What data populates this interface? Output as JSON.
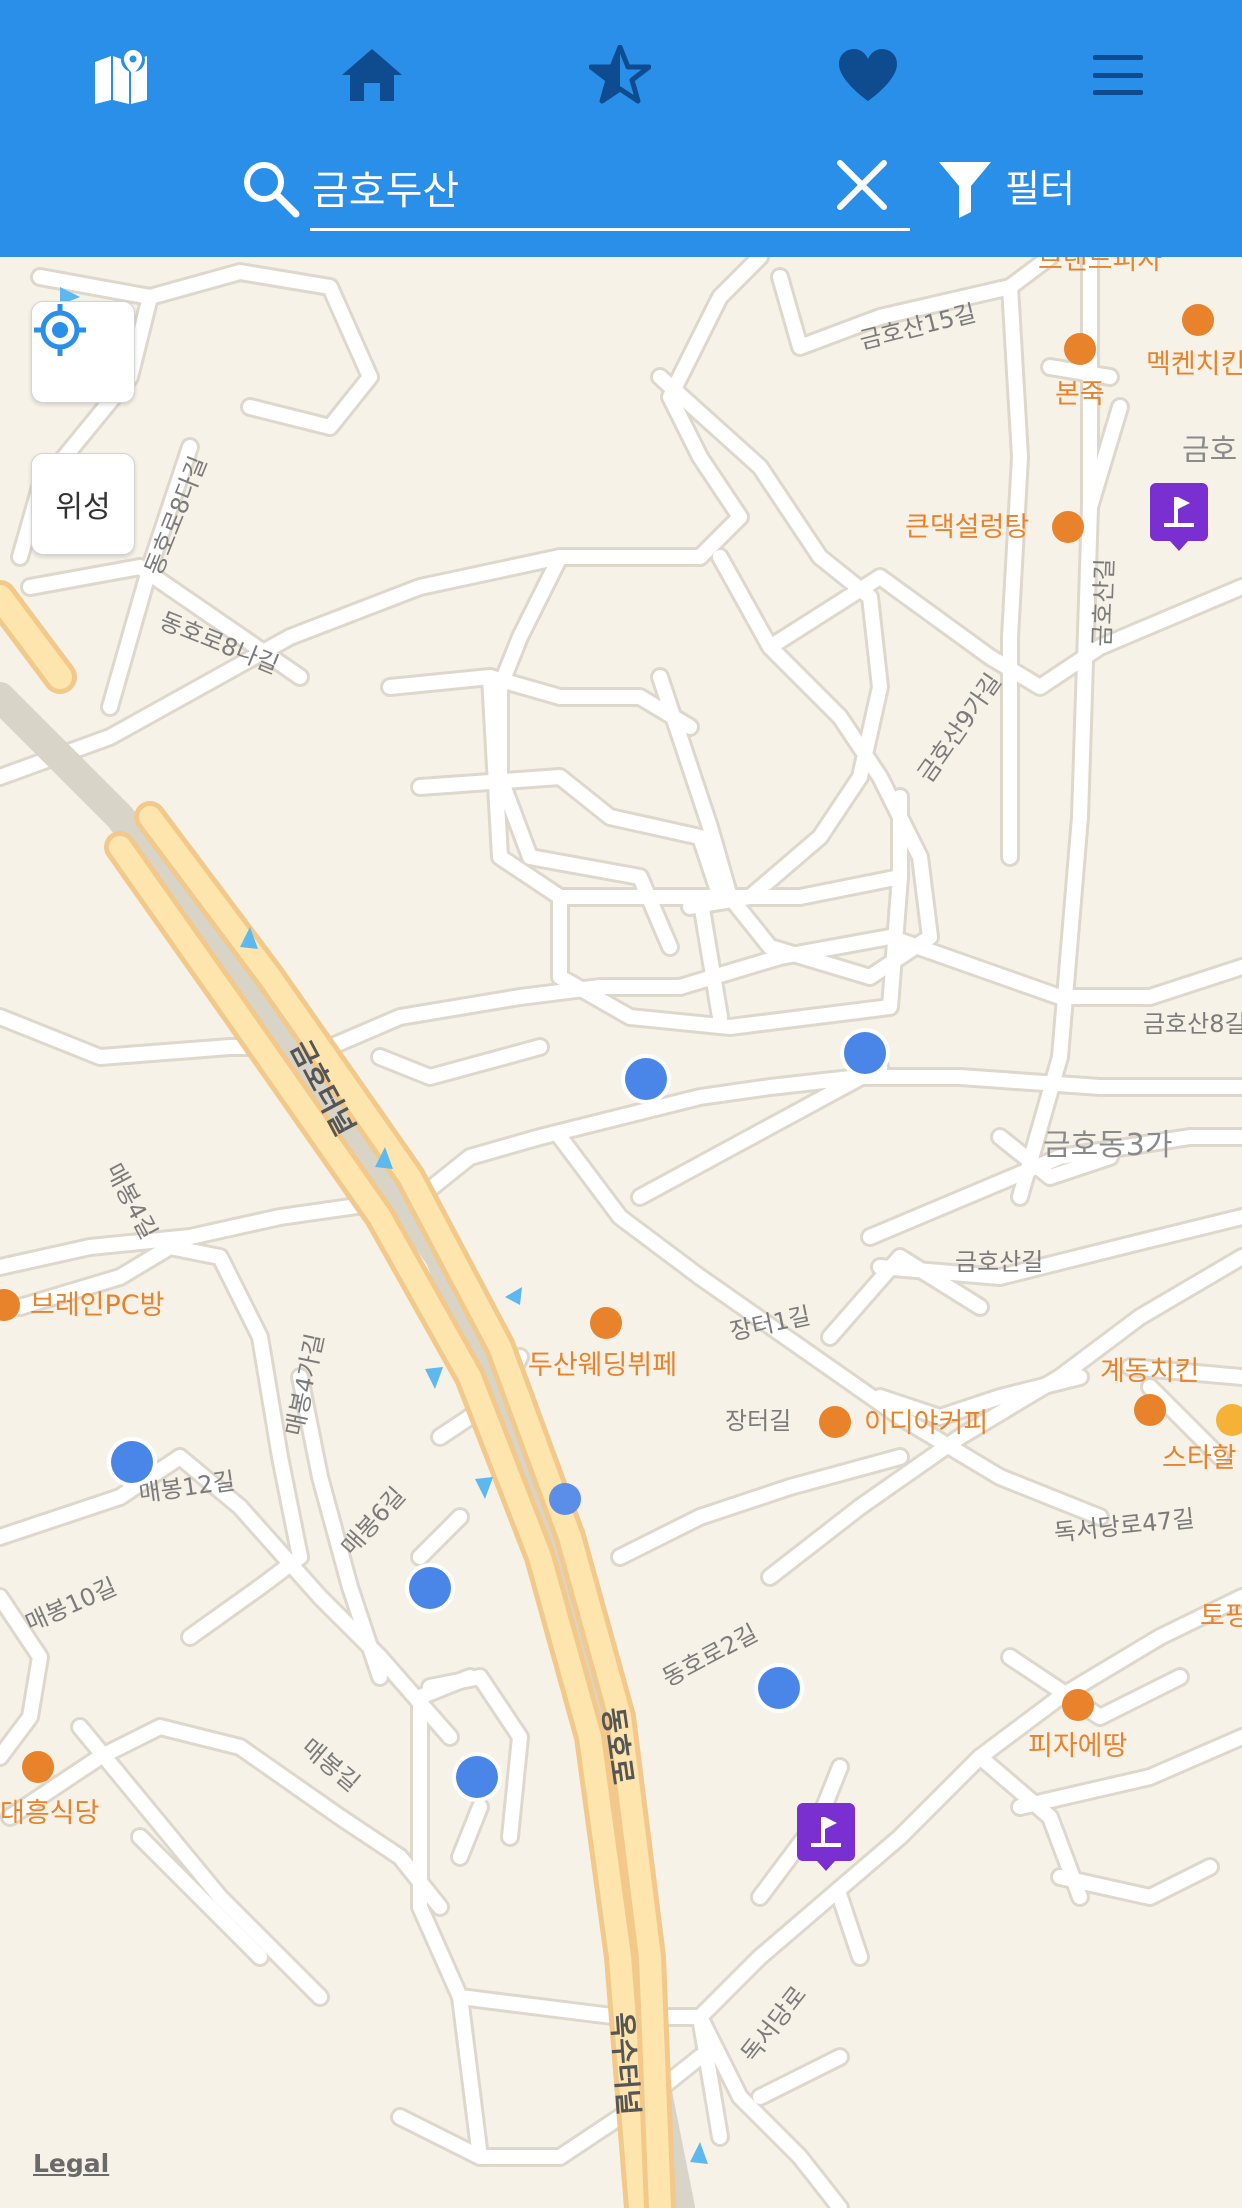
{
  "nav": {
    "icons": [
      "map-icon",
      "home-icon",
      "star-icon",
      "heart-icon",
      "menu-icon"
    ]
  },
  "search": {
    "value": "금호두산",
    "filter_label": "필터"
  },
  "map": {
    "satellite_label": "위성",
    "legal": "Legal",
    "streets": {
      "geumhosan15": "금호산15길",
      "dongho8da": "동호로8다길",
      "dongho8na": "동호로8나길",
      "geumhosan": "금호산길",
      "geumhosan9ga": "금호산9가길",
      "geumhosan8": "금호산8길",
      "geumhosan_short": "금호산길",
      "maebong4": "매봉4길",
      "maebong4ga": "매봉4가길",
      "maebong12": "매봉12길",
      "maebong6": "매봉6길",
      "maebong10": "매봉10길",
      "maebong": "매봉길",
      "jangteo1": "장터1길",
      "jangteo": "장터길",
      "dokseodang47": "독서당로47길",
      "dongho2": "동호로2길",
      "dokseodang": "독서당로",
      "geumho_tunnel": "금호터널",
      "dongho": "동호로",
      "oksu_tunnel": "옥수터널"
    },
    "area_label": "금호동3가",
    "pois": {
      "brand_pizza": "브랜드피자",
      "mexicana": "멕켄치킨",
      "bonjuk": "본죽",
      "keundaek": "큰댁설렁탕",
      "brain_pc": "브레인PC방",
      "doosan_wedding": "두산웨딩뷔페",
      "ediya": "이디야커피",
      "gyedong": "계동치킨",
      "starbucks": "스타할",
      "topping": "토핑",
      "pizza_etang": "피자에땅",
      "daeheung": "대흥식당",
      "geumho_edge": "금호"
    },
    "colors": {
      "header": "#2a8fe8",
      "marker_blue": "#4a86e8",
      "marker_purple": "#7a2fd0",
      "poi_orange": "#e8832c"
    }
  }
}
